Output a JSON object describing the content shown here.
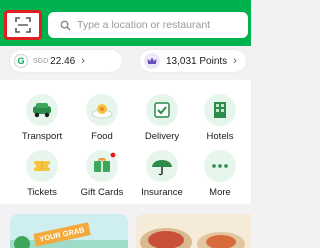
{
  "header": {
    "search": {
      "placeholder": "Type a location or restaurant"
    },
    "scan_icon": "scan-icon",
    "search_icon": "search-icon"
  },
  "wallet": {
    "badge": "G",
    "currency": "SGD",
    "amount": "22.46",
    "chevron": "›"
  },
  "points": {
    "icon": "crown-icon",
    "label": "13,031 Points",
    "chevron": "›"
  },
  "services": [
    {
      "label": "Transport",
      "icon": "car-icon"
    },
    {
      "label": "Food",
      "icon": "food-icon"
    },
    {
      "label": "Delivery",
      "icon": "delivery-icon"
    },
    {
      "label": "Hotels",
      "icon": "hotel-icon"
    },
    {
      "label": "Tickets",
      "icon": "ticket-icon"
    },
    {
      "label": "Gift Cards",
      "icon": "gift-card-icon",
      "badge": true
    },
    {
      "label": "Insurance",
      "icon": "insurance-icon"
    },
    {
      "label": "More",
      "icon": "more-icon"
    }
  ],
  "promos": {
    "left_banner": "YOUR GRAB"
  },
  "colors": {
    "brand_green": "#00b14f",
    "highlight_red": "#e02020",
    "background": "#f2f2f4"
  }
}
